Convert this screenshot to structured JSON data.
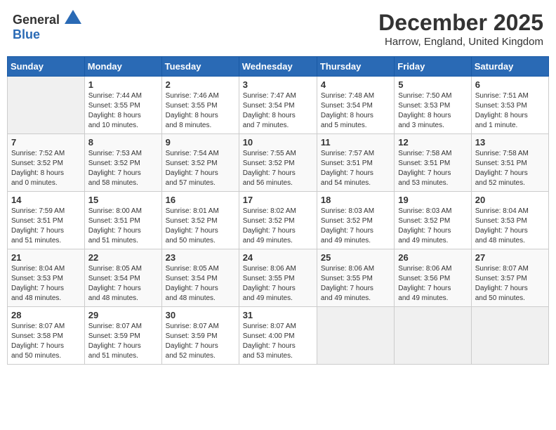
{
  "header": {
    "logo_general": "General",
    "logo_blue": "Blue",
    "month_title": "December 2025",
    "location": "Harrow, England, United Kingdom"
  },
  "days_of_week": [
    "Sunday",
    "Monday",
    "Tuesday",
    "Wednesday",
    "Thursday",
    "Friday",
    "Saturday"
  ],
  "weeks": [
    [
      {
        "day": "",
        "info": ""
      },
      {
        "day": "1",
        "info": "Sunrise: 7:44 AM\nSunset: 3:55 PM\nDaylight: 8 hours\nand 10 minutes."
      },
      {
        "day": "2",
        "info": "Sunrise: 7:46 AM\nSunset: 3:55 PM\nDaylight: 8 hours\nand 8 minutes."
      },
      {
        "day": "3",
        "info": "Sunrise: 7:47 AM\nSunset: 3:54 PM\nDaylight: 8 hours\nand 7 minutes."
      },
      {
        "day": "4",
        "info": "Sunrise: 7:48 AM\nSunset: 3:54 PM\nDaylight: 8 hours\nand 5 minutes."
      },
      {
        "day": "5",
        "info": "Sunrise: 7:50 AM\nSunset: 3:53 PM\nDaylight: 8 hours\nand 3 minutes."
      },
      {
        "day": "6",
        "info": "Sunrise: 7:51 AM\nSunset: 3:53 PM\nDaylight: 8 hours\nand 1 minute."
      }
    ],
    [
      {
        "day": "7",
        "info": "Sunrise: 7:52 AM\nSunset: 3:52 PM\nDaylight: 8 hours\nand 0 minutes."
      },
      {
        "day": "8",
        "info": "Sunrise: 7:53 AM\nSunset: 3:52 PM\nDaylight: 7 hours\nand 58 minutes."
      },
      {
        "day": "9",
        "info": "Sunrise: 7:54 AM\nSunset: 3:52 PM\nDaylight: 7 hours\nand 57 minutes."
      },
      {
        "day": "10",
        "info": "Sunrise: 7:55 AM\nSunset: 3:52 PM\nDaylight: 7 hours\nand 56 minutes."
      },
      {
        "day": "11",
        "info": "Sunrise: 7:57 AM\nSunset: 3:51 PM\nDaylight: 7 hours\nand 54 minutes."
      },
      {
        "day": "12",
        "info": "Sunrise: 7:58 AM\nSunset: 3:51 PM\nDaylight: 7 hours\nand 53 minutes."
      },
      {
        "day": "13",
        "info": "Sunrise: 7:58 AM\nSunset: 3:51 PM\nDaylight: 7 hours\nand 52 minutes."
      }
    ],
    [
      {
        "day": "14",
        "info": "Sunrise: 7:59 AM\nSunset: 3:51 PM\nDaylight: 7 hours\nand 51 minutes."
      },
      {
        "day": "15",
        "info": "Sunrise: 8:00 AM\nSunset: 3:51 PM\nDaylight: 7 hours\nand 51 minutes."
      },
      {
        "day": "16",
        "info": "Sunrise: 8:01 AM\nSunset: 3:52 PM\nDaylight: 7 hours\nand 50 minutes."
      },
      {
        "day": "17",
        "info": "Sunrise: 8:02 AM\nSunset: 3:52 PM\nDaylight: 7 hours\nand 49 minutes."
      },
      {
        "day": "18",
        "info": "Sunrise: 8:03 AM\nSunset: 3:52 PM\nDaylight: 7 hours\nand 49 minutes."
      },
      {
        "day": "19",
        "info": "Sunrise: 8:03 AM\nSunset: 3:52 PM\nDaylight: 7 hours\nand 49 minutes."
      },
      {
        "day": "20",
        "info": "Sunrise: 8:04 AM\nSunset: 3:53 PM\nDaylight: 7 hours\nand 48 minutes."
      }
    ],
    [
      {
        "day": "21",
        "info": "Sunrise: 8:04 AM\nSunset: 3:53 PM\nDaylight: 7 hours\nand 48 minutes."
      },
      {
        "day": "22",
        "info": "Sunrise: 8:05 AM\nSunset: 3:54 PM\nDaylight: 7 hours\nand 48 minutes."
      },
      {
        "day": "23",
        "info": "Sunrise: 8:05 AM\nSunset: 3:54 PM\nDaylight: 7 hours\nand 48 minutes."
      },
      {
        "day": "24",
        "info": "Sunrise: 8:06 AM\nSunset: 3:55 PM\nDaylight: 7 hours\nand 49 minutes."
      },
      {
        "day": "25",
        "info": "Sunrise: 8:06 AM\nSunset: 3:55 PM\nDaylight: 7 hours\nand 49 minutes."
      },
      {
        "day": "26",
        "info": "Sunrise: 8:06 AM\nSunset: 3:56 PM\nDaylight: 7 hours\nand 49 minutes."
      },
      {
        "day": "27",
        "info": "Sunrise: 8:07 AM\nSunset: 3:57 PM\nDaylight: 7 hours\nand 50 minutes."
      }
    ],
    [
      {
        "day": "28",
        "info": "Sunrise: 8:07 AM\nSunset: 3:58 PM\nDaylight: 7 hours\nand 50 minutes."
      },
      {
        "day": "29",
        "info": "Sunrise: 8:07 AM\nSunset: 3:59 PM\nDaylight: 7 hours\nand 51 minutes."
      },
      {
        "day": "30",
        "info": "Sunrise: 8:07 AM\nSunset: 3:59 PM\nDaylight: 7 hours\nand 52 minutes."
      },
      {
        "day": "31",
        "info": "Sunrise: 8:07 AM\nSunset: 4:00 PM\nDaylight: 7 hours\nand 53 minutes."
      },
      {
        "day": "",
        "info": ""
      },
      {
        "day": "",
        "info": ""
      },
      {
        "day": "",
        "info": ""
      }
    ]
  ]
}
